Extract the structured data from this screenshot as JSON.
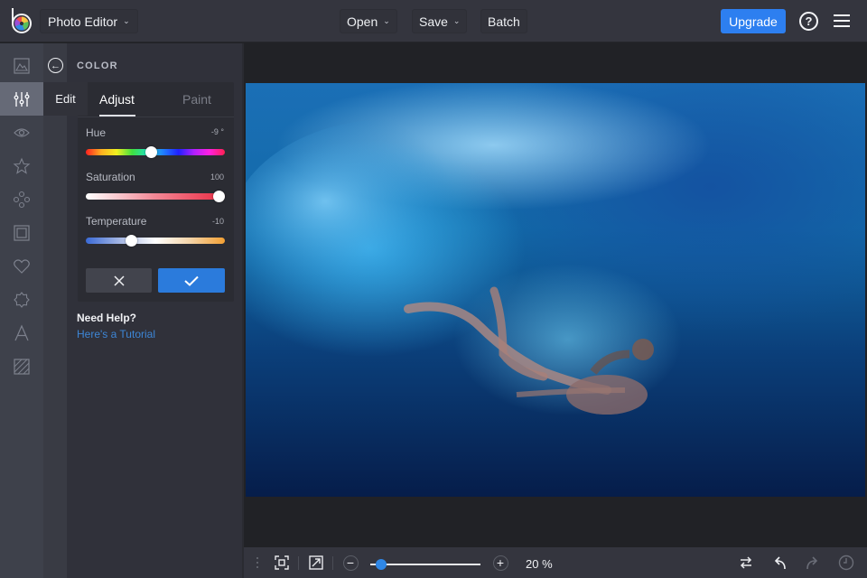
{
  "header": {
    "app_title": "Photo Editor",
    "menu": [
      {
        "label": "Open"
      },
      {
        "label": "Save"
      },
      {
        "label": "Batch"
      }
    ],
    "upgrade_label": "Upgrade",
    "help_label": "?",
    "icons": {
      "logo": "befunky-logo",
      "help": "help-icon",
      "menu": "hamburger-icon"
    }
  },
  "rail": {
    "items": [
      {
        "name": "image-manager",
        "icon": "image-icon"
      },
      {
        "name": "edit",
        "icon": "sliders-icon",
        "active": true,
        "tooltip": "Edit"
      },
      {
        "name": "touch-up",
        "icon": "eye-icon"
      },
      {
        "name": "effects",
        "icon": "star-icon"
      },
      {
        "name": "artsy",
        "icon": "circles-icon"
      },
      {
        "name": "frames",
        "icon": "frame-icon"
      },
      {
        "name": "graphics",
        "icon": "heart-icon"
      },
      {
        "name": "overlays",
        "icon": "badge-icon"
      },
      {
        "name": "text",
        "icon": "text-icon"
      },
      {
        "name": "textures",
        "icon": "texture-icon"
      }
    ]
  },
  "panel": {
    "title": "COLOR",
    "tabs": [
      {
        "label": "Adjust",
        "active": true
      },
      {
        "label": "Paint",
        "active": false
      }
    ],
    "sliders": [
      {
        "label": "Hue",
        "value_text": "-9 °",
        "position": 0.47
      },
      {
        "label": "Saturation",
        "value_text": "100",
        "position": 1.0
      },
      {
        "label": "Temperature",
        "value_text": "-10",
        "position": 0.31
      }
    ],
    "cancel_icon": "close-icon",
    "apply_icon": "check-icon",
    "help_title": "Need Help?",
    "help_link": "Here's a Tutorial"
  },
  "bottom": {
    "zoom_text": "20 %",
    "zoom_fraction": 0.05
  },
  "colors": {
    "accent": "#2d7ff0",
    "topbar": "#34353e",
    "rail": "#3e414b",
    "panel": "#30313a",
    "link": "#3d86d6"
  }
}
